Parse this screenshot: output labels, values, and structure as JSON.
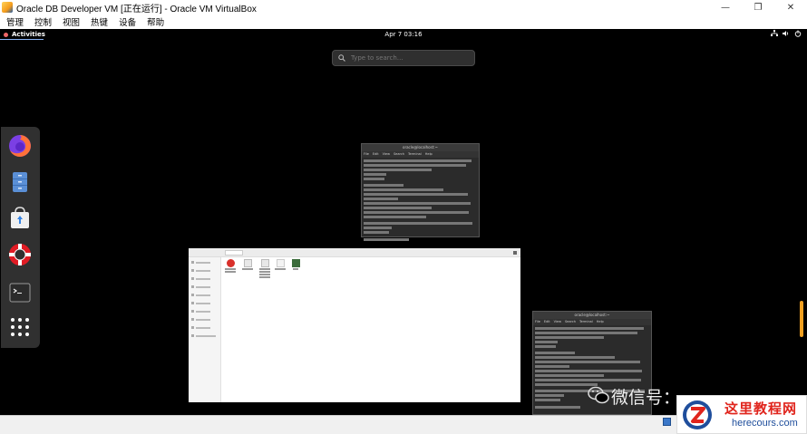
{
  "window": {
    "title": "Oracle DB Developer VM [正在运行] - Oracle VM VirtualBox",
    "minimize_symbol": "—",
    "maximize_symbol": "❐",
    "close_symbol": "✕"
  },
  "menubar": {
    "items": [
      "管理",
      "控制",
      "视图",
      "热键",
      "设备",
      "帮助"
    ]
  },
  "gnome": {
    "activities_label": "Activities",
    "clock": "Apr 7  03:16",
    "search_placeholder": "Type to search…"
  },
  "dash": {
    "apps": [
      "firefox-icon",
      "files-icon",
      "software-icon",
      "help-icon",
      "terminal-icon",
      "show-apps-icon"
    ]
  },
  "windows": {
    "terminal_small_title": "oracle@localhost:~",
    "terminal_large_title": "oracle@localhost:~",
    "terminal_menu": [
      "File",
      "Edit",
      "View",
      "Search",
      "Terminal",
      "Help"
    ]
  },
  "watermark": {
    "text": "微信号：",
    "logo_title": "这里教程网",
    "logo_url": "herecours.com"
  },
  "colors": {
    "vm_background": "#000000",
    "dash_background": "#303030",
    "accent_logo_red": "#e0241c",
    "accent_logo_blue": "#1f4e9c"
  }
}
